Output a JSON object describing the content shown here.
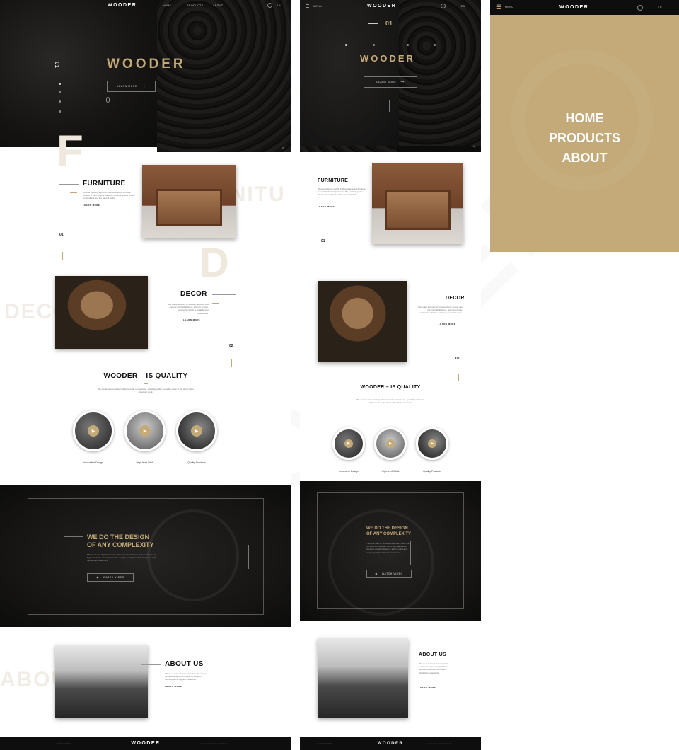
{
  "brand": {
    "logo": "WOODER",
    "accent": "#c4aa79"
  },
  "nav": {
    "home": "HOME",
    "products": "PRODUCTS",
    "about": "ABOUT",
    "lang": "EN",
    "menu": "MENU"
  },
  "hero": {
    "index": "01",
    "title": "WOODER",
    "button": "LEARN MORE"
  },
  "furniture": {
    "title": "FURNITURE",
    "letter": "F",
    "watermark": "FURNITU",
    "text": "Wooder delivers stylish & affordable wood furniture curated in their original state. By combining wise choice of woodland and the natural finish.",
    "link": "LEARN MORE",
    "index": "01"
  },
  "decor": {
    "title": "DECOR",
    "letter": "D",
    "watermark": "DECOR",
    "text": "We make all types of wooden decor so you can put yourself at home. Easy or unique, customize which is suitable your preferences.",
    "link": "LEARN MORE",
    "index": "02"
  },
  "quality": {
    "title": "WOODER – IS QUALITY",
    "text": "We create unique design objects made of raw wood, specially under the order. Look at the short video about our work.",
    "items": [
      "Innovative Design",
      "High-level Skills",
      "Quality Products"
    ]
  },
  "design": {
    "title_line1": "WE DO THE DESIGN",
    "title_line2": "OF ANY COMPLEXITY",
    "text": "This is a team of professionals that create the furniture and wooden art of high standards. Creating wooden designs, adding solid and unique quality furniture to customers.",
    "button": "WATCH VIDEO"
  },
  "about": {
    "title": "ABOUT US",
    "watermark": "ABOUT",
    "text": "We are a team of professionals in the wood processing with the number of wooden furniture of the highest standards.",
    "link": "LEARN MORE"
  },
  "footer": {
    "logo": "WOODER",
    "left": "2019 WOODER",
    "right": "Designed by Wooder Studio"
  },
  "mobile_menu": {
    "items": [
      "HOME",
      "PRODUCTS",
      "ABOUT"
    ]
  }
}
